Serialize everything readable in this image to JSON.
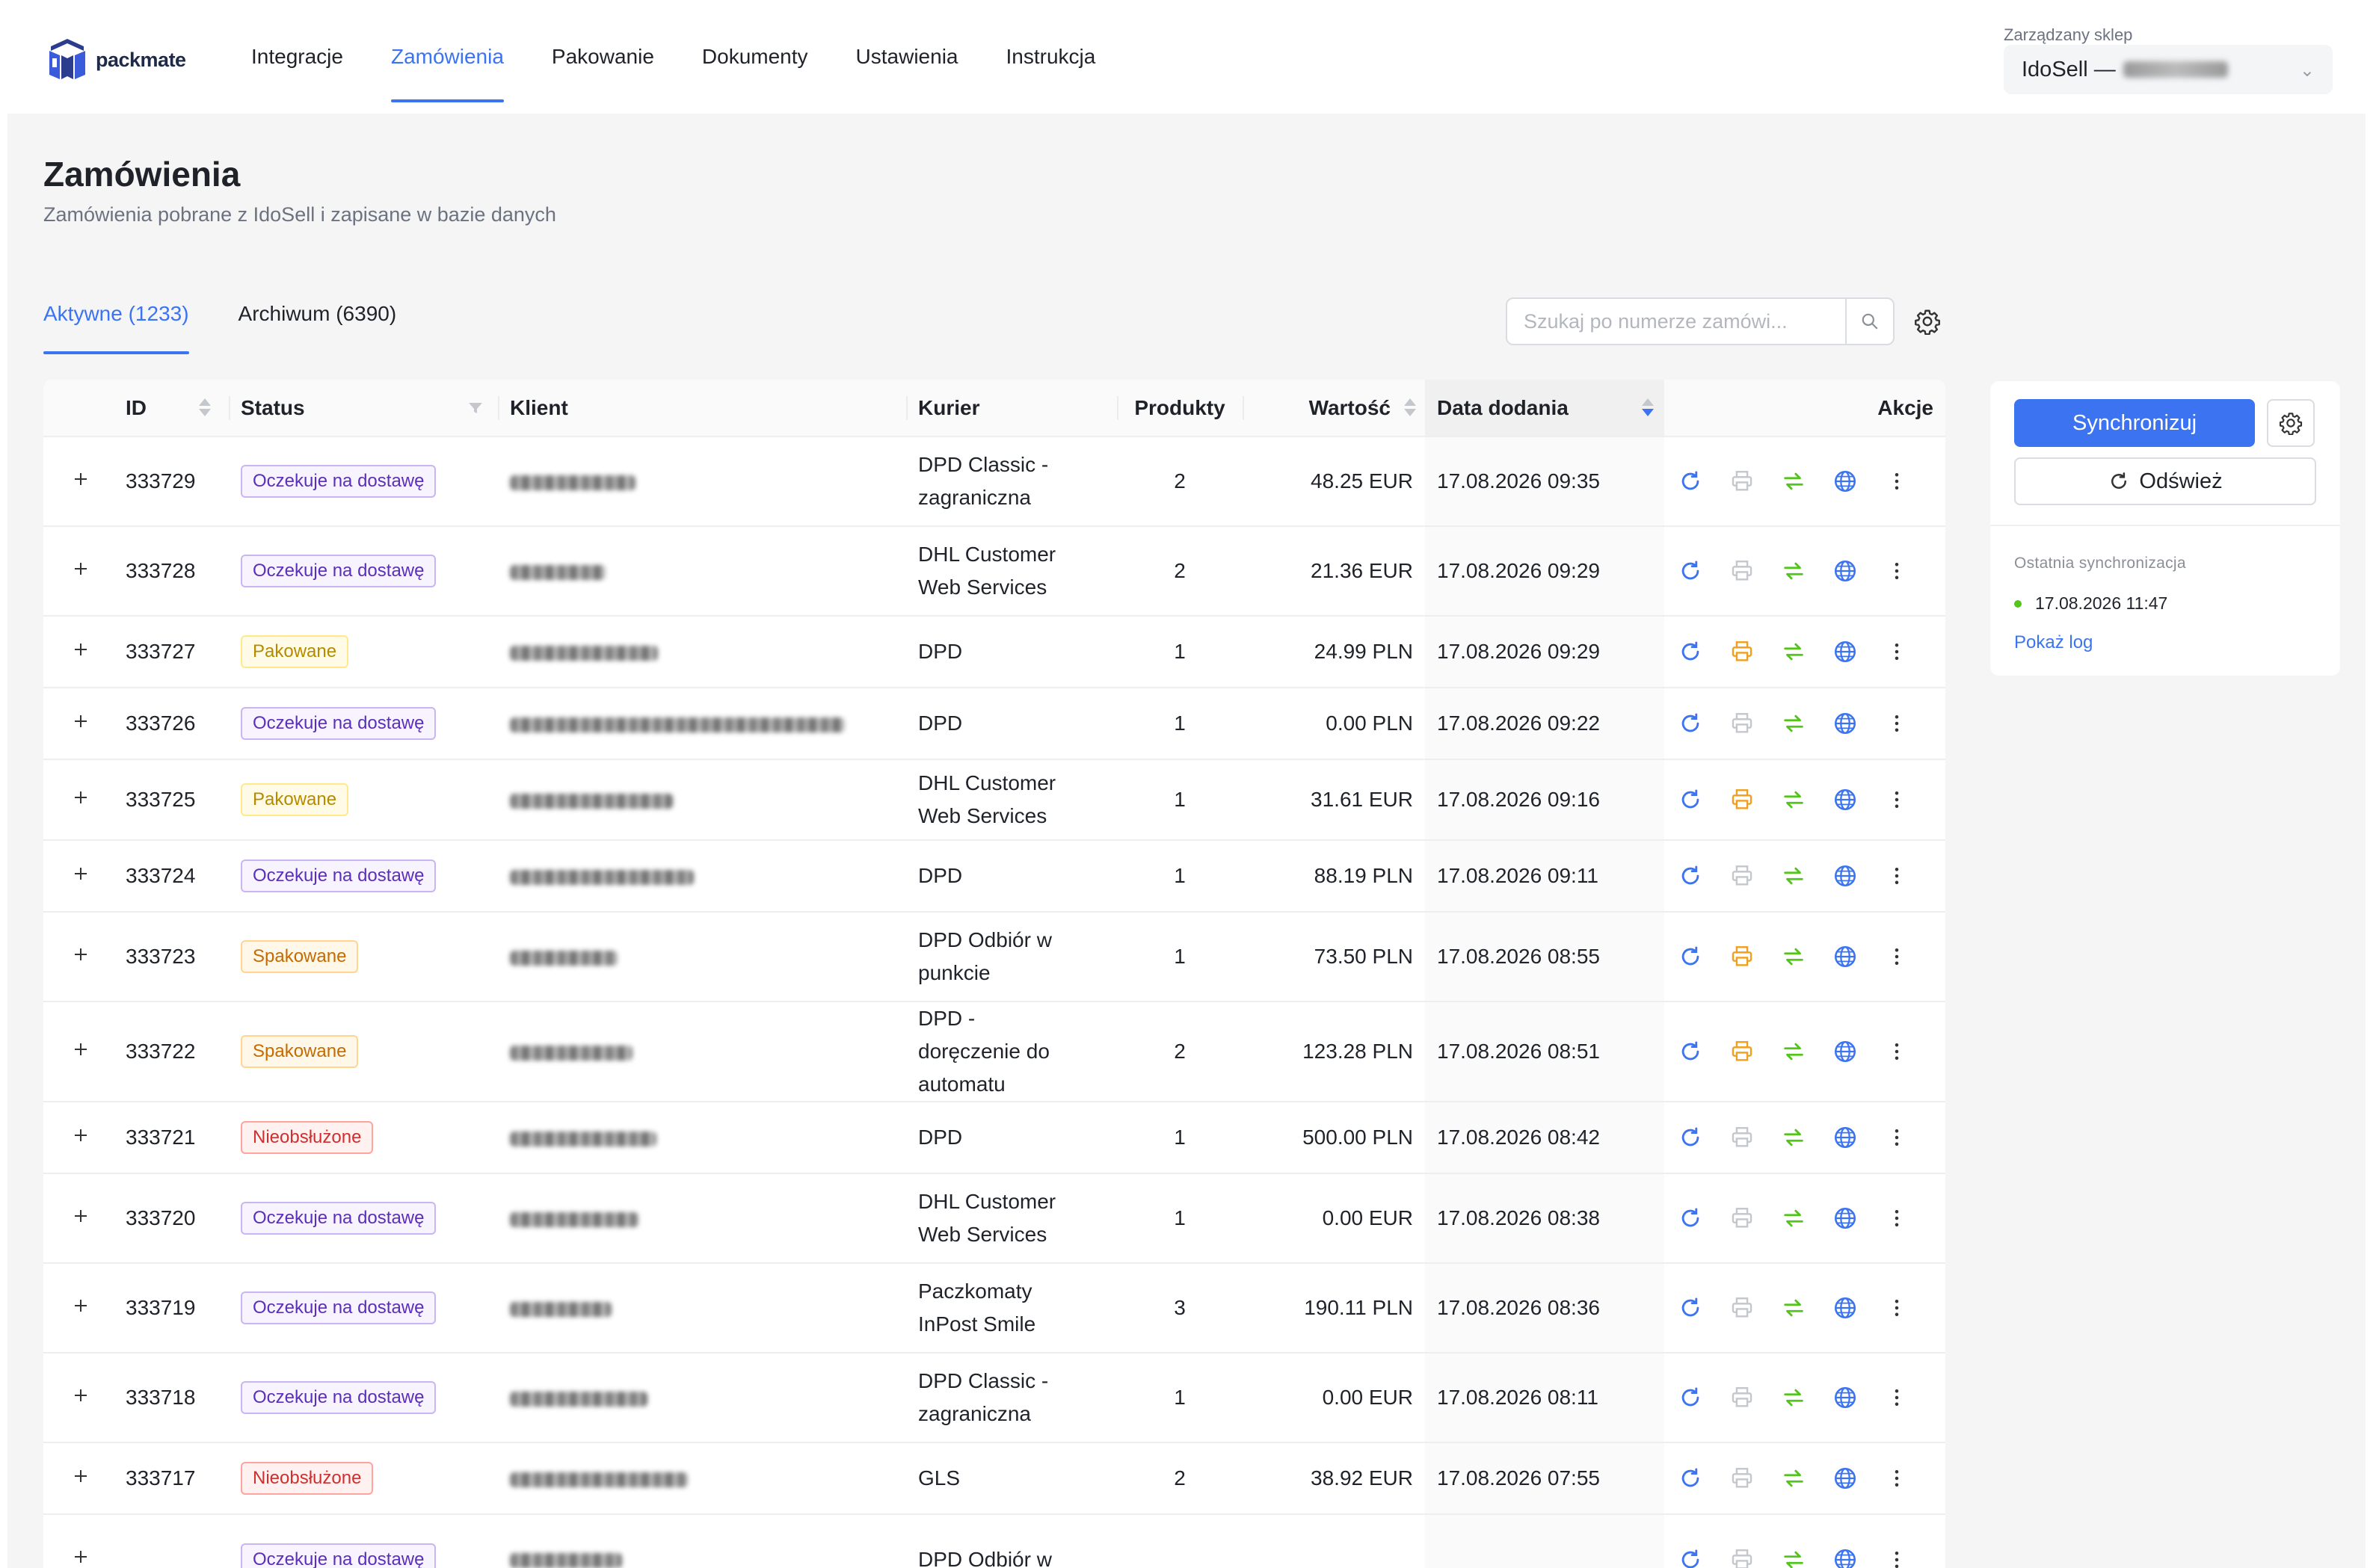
{
  "header": {
    "logo_text": "packmate",
    "nav": [
      {
        "label": "Integracje",
        "active": false
      },
      {
        "label": "Zamówienia",
        "active": true
      },
      {
        "label": "Pakowanie",
        "active": false
      },
      {
        "label": "Dokumenty",
        "active": false
      },
      {
        "label": "Ustawienia",
        "active": false
      },
      {
        "label": "Instrukcja",
        "active": false
      }
    ],
    "store_label": "Zarządzany sklep",
    "store_value": "IdoSell —"
  },
  "page": {
    "title": "Zamówienia",
    "subtitle": "Zamówienia pobrane z IdoSell i zapisane w bazie danych"
  },
  "tabs": [
    {
      "label": "Aktywne (1233)",
      "active": true
    },
    {
      "label": "Archiwum (6390)",
      "active": false
    }
  ],
  "search": {
    "placeholder": "Szukaj po numerze zamówi...",
    "value": ""
  },
  "table": {
    "columns": {
      "id": "ID",
      "status": "Status",
      "client": "Klient",
      "courier": "Kurier",
      "products": "Produkty",
      "value": "Wartość",
      "date": "Data dodania",
      "actions": "Akcje"
    },
    "rows": [
      {
        "id": "333729",
        "status": "Oczekuje na dostawę",
        "status_type": "oczekuje",
        "courier": "DPD Classic - zagraniczna",
        "products": "2",
        "value": "48.25 EUR",
        "date": "17.08.2026 09:35",
        "print_active": false
      },
      {
        "id": "333728",
        "status": "Oczekuje na dostawę",
        "status_type": "oczekuje",
        "courier": "DHL Customer Web Services",
        "products": "2",
        "value": "21.36 EUR",
        "date": "17.08.2026 09:29",
        "print_active": false
      },
      {
        "id": "333727",
        "status": "Pakowane",
        "status_type": "pakowane",
        "courier": "DPD",
        "products": "1",
        "value": "24.99 PLN",
        "date": "17.08.2026 09:29",
        "print_active": true
      },
      {
        "id": "333726",
        "status": "Oczekuje na dostawę",
        "status_type": "oczekuje",
        "courier": "DPD",
        "products": "1",
        "value": "0.00 PLN",
        "date": "17.08.2026 09:22",
        "print_active": false
      },
      {
        "id": "333725",
        "status": "Pakowane",
        "status_type": "pakowane",
        "courier": "DHL Customer Web Services",
        "products": "1",
        "value": "31.61 EUR",
        "date": "17.08.2026 09:16",
        "print_active": true
      },
      {
        "id": "333724",
        "status": "Oczekuje na dostawę",
        "status_type": "oczekuje",
        "courier": "DPD",
        "products": "1",
        "value": "88.19 PLN",
        "date": "17.08.2026 09:11",
        "print_active": false
      },
      {
        "id": "333723",
        "status": "Spakowane",
        "status_type": "spakowane",
        "courier": "DPD Odbiór w punkcie",
        "products": "1",
        "value": "73.50 PLN",
        "date": "17.08.2026 08:55",
        "print_active": true
      },
      {
        "id": "333722",
        "status": "Spakowane",
        "status_type": "spakowane",
        "courier": "DPD - doręczenie do automatu",
        "products": "2",
        "value": "123.28 PLN",
        "date": "17.08.2026 08:51",
        "print_active": true
      },
      {
        "id": "333721",
        "status": "Nieobsłużone",
        "status_type": "nieobs",
        "courier": "DPD",
        "products": "1",
        "value": "500.00 PLN",
        "date": "17.08.2026 08:42",
        "print_active": false
      },
      {
        "id": "333720",
        "status": "Oczekuje na dostawę",
        "status_type": "oczekuje",
        "courier": "DHL Customer Web Services",
        "products": "1",
        "value": "0.00 EUR",
        "date": "17.08.2026 08:38",
        "print_active": false
      },
      {
        "id": "333719",
        "status": "Oczekuje na dostawę",
        "status_type": "oczekuje",
        "courier": "Paczkomaty InPost Smile",
        "products": "3",
        "value": "190.11 PLN",
        "date": "17.08.2026 08:36",
        "print_active": false
      },
      {
        "id": "333718",
        "status": "Oczekuje na dostawę",
        "status_type": "oczekuje",
        "courier": "DPD Classic - zagraniczna",
        "products": "1",
        "value": "0.00 EUR",
        "date": "17.08.2026 08:11",
        "print_active": false
      },
      {
        "id": "333717",
        "status": "Nieobsłużone",
        "status_type": "nieobs",
        "courier": "GLS",
        "products": "2",
        "value": "38.92 EUR",
        "date": "17.08.2026 07:55",
        "print_active": false
      },
      {
        "id": "",
        "status": "Oczekuje na dostawę",
        "status_type": "oczekuje",
        "courier": "DPD Odbiór w",
        "products": "",
        "value": "",
        "date": "",
        "print_active": false
      }
    ]
  },
  "sidebar": {
    "sync_label": "Synchronizuj",
    "refresh_label": "Odśwież",
    "last_sync_label": "Ostatnia synchronizacja",
    "last_sync_value": "17.08.2026 11:47",
    "show_log_label": "Pokaż log"
  },
  "colors": {
    "accent": "#3b73f0",
    "status_ok": "#52c41a",
    "print_active": "#f0a020",
    "transfer": "#52c41a"
  }
}
